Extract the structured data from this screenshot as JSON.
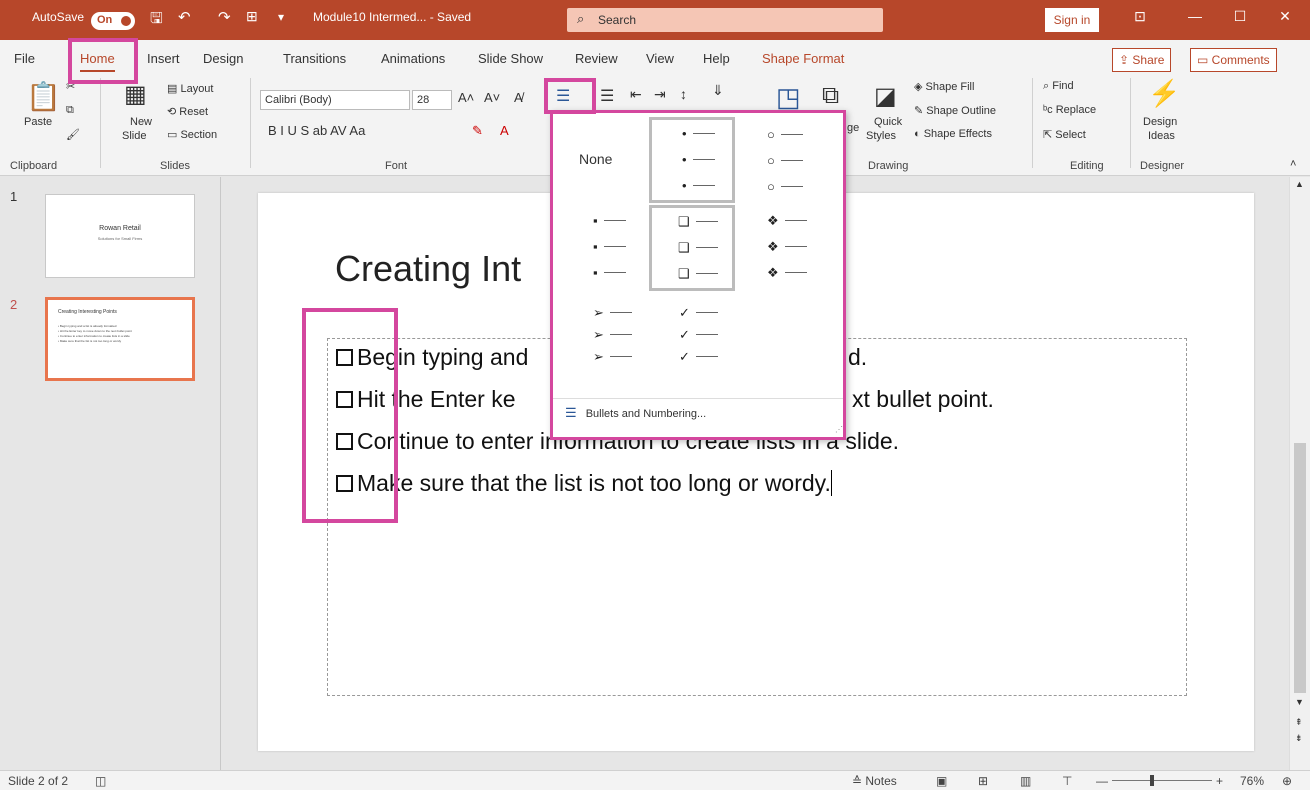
{
  "titlebar": {
    "autosave_label": "AutoSave",
    "autosave_state": "On",
    "doc_title": "Module10 Intermed... - Saved",
    "search_placeholder": "Search",
    "signin_label": "Sign in"
  },
  "tabs": [
    "File",
    "Home",
    "Insert",
    "Design",
    "Transitions",
    "Animations",
    "Slide Show",
    "Review",
    "View",
    "Help",
    "Shape Format"
  ],
  "share_label": "Share",
  "comments_label": "Comments",
  "ribbon": {
    "clipboard": {
      "paste": "Paste",
      "label": "Clipboard"
    },
    "slides": {
      "new_slide": "New",
      "new_slide2": "Slide",
      "layout": "Layout",
      "reset": "Reset",
      "section": "Section",
      "label": "Slides"
    },
    "font": {
      "font_name": "Calibri (Body)",
      "font_size": "28",
      "label": "Font",
      "format_row": "B  I  U  S  ab  AV  Aa"
    },
    "drawing": {
      "shape_fill": "Shape Fill",
      "shape_outline": "Shape Outline",
      "shape_effects": "Shape Effects",
      "quick": "Quick",
      "styles": "Styles",
      "label": "Drawing",
      "ge": "ge"
    },
    "editing": {
      "find": "Find",
      "replace": "Replace",
      "select": "Select",
      "label": "Editing"
    },
    "designer": {
      "design": "Design",
      "ideas": "Ideas",
      "label": "Designer"
    }
  },
  "thumbnails": [
    {
      "num": "1",
      "title": "Rowan Retail",
      "subtitle": "Solutions for Small Firms"
    },
    {
      "num": "2",
      "title": "Creating Interesting Points",
      "lines": [
        "• Begin typing and a list is already formatted",
        "• Hit the Enter key to move down to the next bullet point",
        "• Continue to enter information to create lists in a slide",
        "• Make sure that the list is not too long or wordy"
      ]
    }
  ],
  "slide": {
    "title": "Creating Int",
    "bullets": [
      "Begin typing and",
      "d.",
      "Hit the Enter ke",
      "xt bullet point.",
      "Continue to enter information to create lists in a slide.",
      "Make sure that the list is not too long or wordy."
    ]
  },
  "dropdown": {
    "none_label": "None",
    "footer_label": "Bullets and Numbering...",
    "bullet_glyphs": {
      "filled_round": "•",
      "hollow_round": "○",
      "filled_square": "▪",
      "hollow_square": "❑",
      "diamond_star": "❖",
      "arrow": "➢",
      "check": "✓"
    }
  },
  "status": {
    "slide_count": "Slide 2 of 2",
    "notes": "Notes",
    "zoom": "76%"
  },
  "colors": {
    "accent": "#b7472a",
    "highlight": "#d4479e",
    "thumb_selected": "#e8754d"
  }
}
